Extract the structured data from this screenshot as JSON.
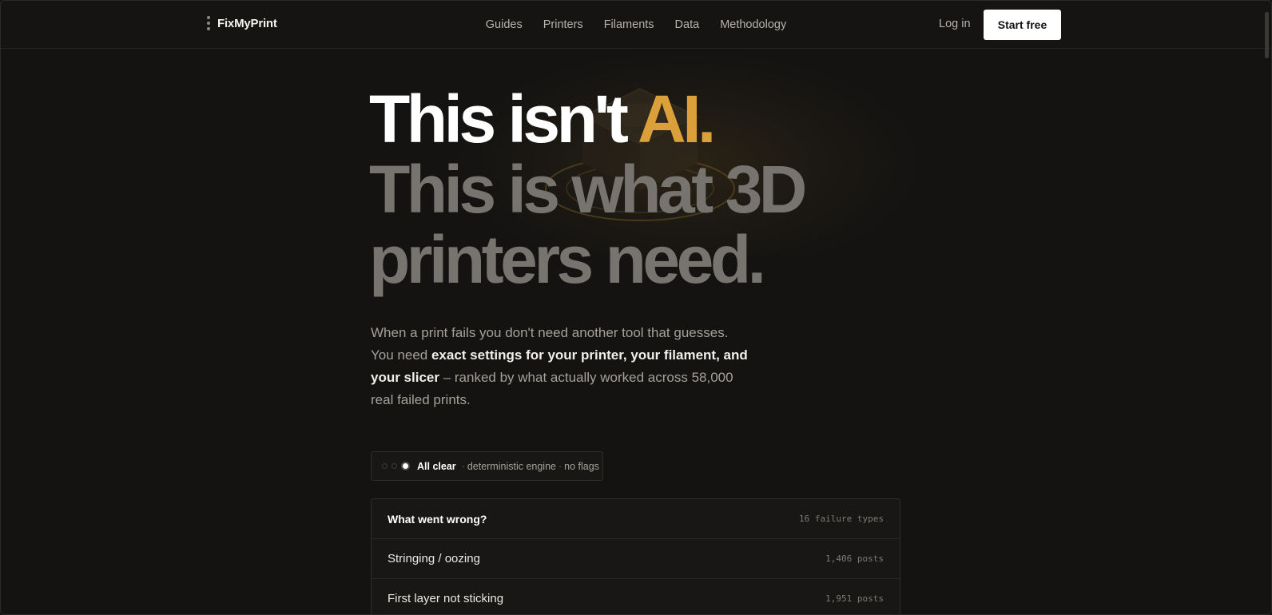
{
  "brand": {
    "name": "FixMyPrint"
  },
  "nav": {
    "items": [
      "Guides",
      "Printers",
      "Filaments",
      "Data",
      "Methodology"
    ],
    "login_label": "Log in",
    "cta_label": "Start free"
  },
  "hero": {
    "line1_prefix": "This isn't ",
    "line1_accent": "AI.",
    "line2": "This is what 3D",
    "line3": "printers need.",
    "lede": {
      "part1": "When a print fails you don't need another tool that guesses. You need ",
      "bold": "exact settings for your printer, your filament, and your slicer",
      "part2": " – ranked by what actually worked across 58,000 real failed prints."
    }
  },
  "status": {
    "title": "All clear",
    "detail1": "deterministic engine",
    "detail2": "no flags",
    "separator": "·"
  },
  "failures": {
    "title": "What went wrong?",
    "meta": "16 failure types",
    "rows": [
      {
        "label": "Stringing / oozing",
        "count": "1,406 posts"
      },
      {
        "label": "First layer not sticking",
        "count": "1,951 posts"
      }
    ]
  },
  "colors": {
    "background": "#141312",
    "accent": "#dba03a",
    "muted_heading": "#77746f",
    "cta_background": "#ffffff"
  }
}
